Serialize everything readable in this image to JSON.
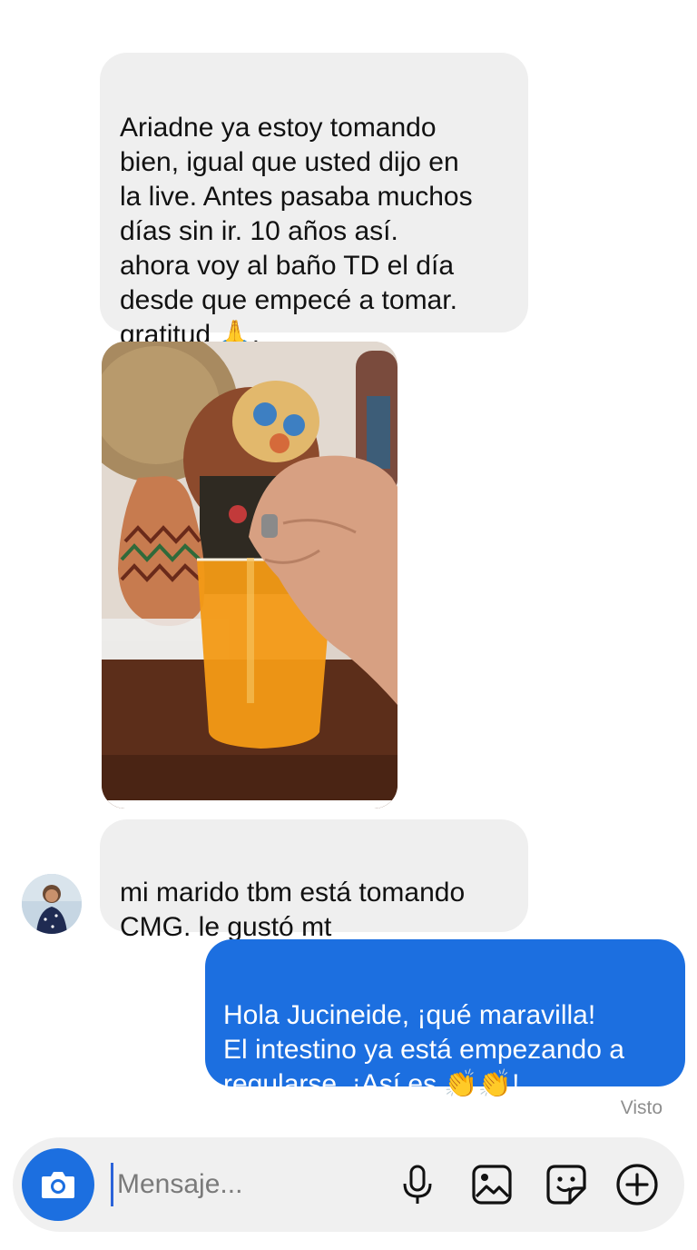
{
  "conversation": {
    "incoming": [
      {
        "text": "Ariadne ya estoy tomando\nbien, igual que usted dijo en\nla live. Antes pasaba muchos\ndías sin ir. 10 años así.\nahora voy al baño TD el día\ndesde que empecé a tomar.\ngratitud 🙏."
      },
      {
        "text": "mi marido tbm está tomando\nCMG. le gustó mt"
      }
    ],
    "outgoing": [
      {
        "text": "Hola Jucineide, ¡qué maravilla!\nEl intestino ya está empezando a\nregularse. ¡Así es 👏👏!"
      }
    ],
    "status": "Visto"
  },
  "composer": {
    "placeholder": "Mensaje...",
    "icons": [
      "camera-icon",
      "microphone-icon",
      "gallery-icon",
      "sticker-icon",
      "plus-icon"
    ]
  },
  "colors": {
    "accent": "#1c6fe0",
    "incoming_bubble": "#efefef",
    "composer_bg": "#f0f0f0"
  }
}
